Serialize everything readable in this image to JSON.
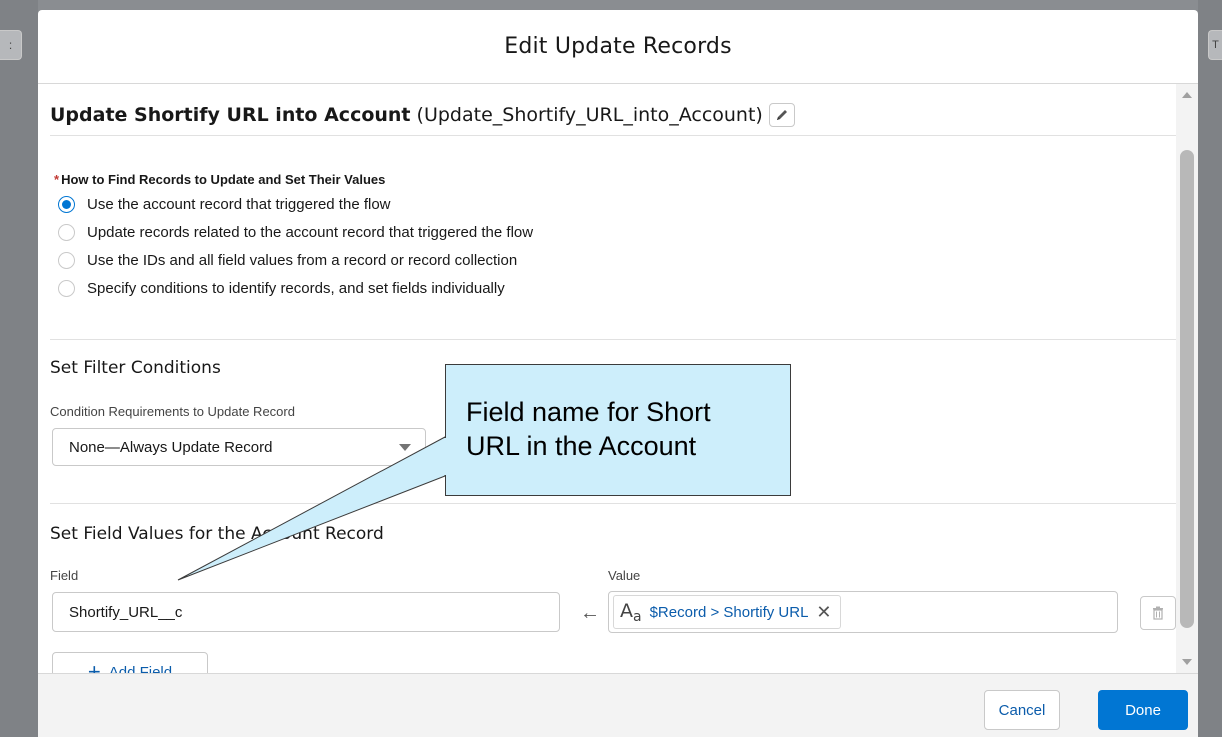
{
  "background": {
    "left_stub_text": ":",
    "right_stub_text": "T"
  },
  "modal": {
    "title": "Edit Update Records",
    "element_label": "Update Shortify URL into Account",
    "element_api_name": "(Update_Shortify_URL_into_Account)",
    "edit_icon": "pencil-icon"
  },
  "how_to_find": {
    "title": "How to Find Records to Update and Set Their Values",
    "required_marker": "*",
    "options": [
      {
        "label": "Use the account record that triggered the flow",
        "selected": true
      },
      {
        "label": "Update records related to the account record that triggered the flow",
        "selected": false
      },
      {
        "label": "Use the IDs and all field values from a record or record collection",
        "selected": false
      },
      {
        "label": "Specify conditions to identify records, and set fields individually",
        "selected": false
      }
    ]
  },
  "filter": {
    "heading": "Set Filter Conditions",
    "condition_label": "Condition Requirements to Update Record",
    "condition_value": "None—Always Update Record"
  },
  "field_values": {
    "heading": "Set Field Values for the Account Record",
    "field_column_label": "Field",
    "value_column_label": "Value",
    "field_value": "Shortify_URL__c",
    "arrow": "←",
    "value_type_icon": "text-type-icon",
    "value_type_main": "A",
    "value_type_sub": "a",
    "value_reference": "$Record > Shortify URL",
    "remove_glyph": "✕",
    "add_field_label": "Add Field",
    "add_icon": "+"
  },
  "footer": {
    "cancel_label": "Cancel",
    "done_label": "Done"
  },
  "callout": {
    "line1": "Field name for Short",
    "line2": "URL in the Account"
  },
  "colors": {
    "brand": "#0176d3",
    "link": "#0b5cab",
    "required": "#c23934",
    "callout_fill": "#cdeefb"
  }
}
